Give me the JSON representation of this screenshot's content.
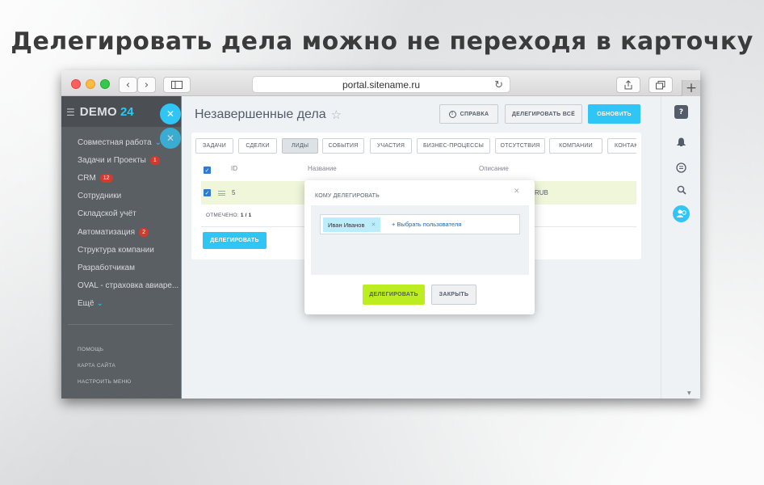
{
  "headline": "Делегировать дела можно не переходя в карточку",
  "browser": {
    "url": "portal.sitename.ru",
    "back_icon": "chevron-left-icon",
    "forward_icon": "chevron-right-icon"
  },
  "sidebar": {
    "logo_main": "DEMO",
    "logo_num": "24",
    "items": [
      {
        "label": "Совместная работа",
        "badge": "",
        "chevron": "⌄"
      },
      {
        "label": "Задачи и Проекты",
        "badge": "1"
      },
      {
        "label": "CRM",
        "badge": "12"
      },
      {
        "label": "Сотрудники",
        "badge": ""
      },
      {
        "label": "Складской учёт",
        "badge": ""
      },
      {
        "label": "Автоматизация",
        "badge": "2"
      },
      {
        "label": "Структура компании",
        "badge": ""
      },
      {
        "label": "Разработчикам",
        "badge": ""
      },
      {
        "label": "OVAL - страховка авиаре...",
        "badge": ""
      },
      {
        "label": "Ещё",
        "badge": "",
        "chevron": "⌄"
      }
    ],
    "footer": [
      "ПОМОЩЬ",
      "КАРТА САЙТА",
      "НАСТРОИТЬ МЕНЮ"
    ]
  },
  "content": {
    "title": "Незавершенные дела",
    "buttons": {
      "help": "СПРАВКА",
      "delegate_all": "ДЕЛЕГИРОВАТЬ ВСЁ",
      "refresh": "ОБНОВИТЬ"
    },
    "tabs": [
      "ЗАДАЧИ",
      "СДЕЛКИ",
      "ЛИДЫ",
      "СОБЫТИЯ",
      "УЧАСТИЯ",
      "БИЗНЕС-ПРОЦЕССЫ",
      "ОТСУТСТВИЯ",
      "КОМПАНИИ",
      "КОНТАКТЫ"
    ],
    "active_tab": "ЛИДЫ",
    "columns": {
      "id": "ID",
      "name": "Название",
      "description": "Описание"
    },
    "row": {
      "id": "5",
      "description_tail": "RUB"
    },
    "marked_label": "ОТМЕЧЕНО:",
    "marked_value": "1 / 1",
    "delegate_button": "ДЕЛЕГИРОВАТЬ"
  },
  "dialog": {
    "title": "КОМУ ДЕЛЕГИРОВАТЬ",
    "chip": "Иван Иванов",
    "add_user": "+ Выбрать пользователя",
    "delegate": "ДЕЛЕГИРОВАТЬ",
    "close": "ЗАКРЫТЬ"
  },
  "colors": {
    "accent": "#2fc6f6",
    "green": "#bbed21",
    "sidebar": "#5a5f63"
  }
}
